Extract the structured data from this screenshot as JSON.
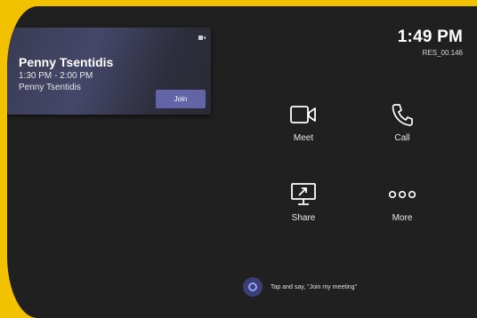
{
  "clock": {
    "time": "1:49 PM",
    "room": "RES_00.146"
  },
  "meeting": {
    "title": "Penny Tsentidis",
    "time_range": "1:30 PM - 2:00 PM",
    "organizer": "Penny Tsentidis",
    "join_label": "Join"
  },
  "actions": [
    {
      "label": "Meet",
      "icon": "video-camera-icon"
    },
    {
      "label": "Call",
      "icon": "phone-icon"
    },
    {
      "label": "Share",
      "icon": "screen-share-icon"
    },
    {
      "label": "More",
      "icon": "more-dots-icon"
    }
  ],
  "cortana": {
    "hint": "Tap and say, \"Join my meeting\""
  },
  "colors": {
    "accent": "#6264a7",
    "frame": "#f2c200",
    "background": "#202020"
  }
}
